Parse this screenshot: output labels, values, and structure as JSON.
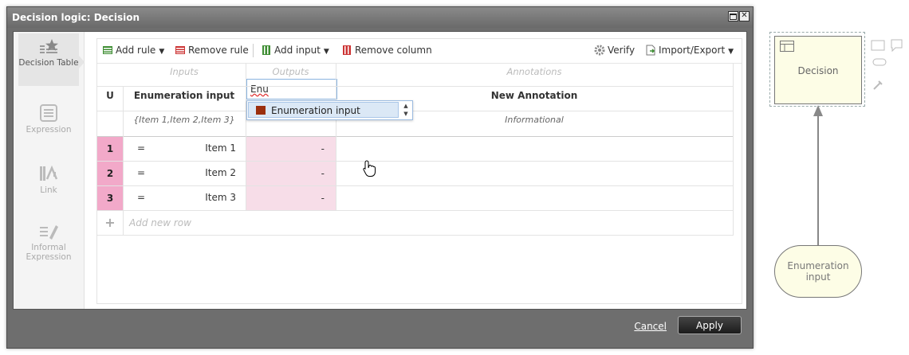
{
  "dialog": {
    "title": "Decision logic: Decision",
    "cancel_label": "Cancel",
    "apply_label": "Apply"
  },
  "nav": {
    "items": [
      {
        "label": "Decision Table",
        "icon": "decision-table-icon",
        "active": true
      },
      {
        "label": "Expression",
        "icon": "expression-icon",
        "active": false
      },
      {
        "label": "Link",
        "icon": "link-icon",
        "active": false
      },
      {
        "label": "Informal Expression",
        "icon": "informal-expression-icon",
        "active": false
      }
    ]
  },
  "toolbar": {
    "add_rule": "Add rule",
    "remove_rule": "Remove rule",
    "add_input": "Add input",
    "remove_column": "Remove column",
    "verify": "Verify",
    "import_export": "Import/Export"
  },
  "table": {
    "section_inputs": "Inputs",
    "section_outputs": "Outputs",
    "section_annotations": "Annotations",
    "hit_policy": "U",
    "input_header": "Enumeration input",
    "output_input_value": "Enu",
    "annotation_header": "New Annotation",
    "input_values_hint": "{Item 1,Item 2,Item 3}",
    "annotation_type": "Informational",
    "rows": [
      {
        "num": "1",
        "op": "=",
        "input": "Item 1",
        "output": "-"
      },
      {
        "num": "2",
        "op": "=",
        "input": "Item 2",
        "output": "-"
      },
      {
        "num": "3",
        "op": "=",
        "input": "Item 3",
        "output": "-"
      }
    ],
    "add_row_placeholder": "Add new row",
    "add_row_symbol": "+"
  },
  "autocomplete": {
    "items": [
      {
        "label": "Enumeration input",
        "swatch_color": "#9b2f0e"
      }
    ]
  },
  "diagram": {
    "decision_label": "Decision",
    "input_label": "Enumeration input"
  },
  "colors": {
    "rule_number_bg": "#f2a9c9",
    "output_cell_bg": "#f7dde8",
    "node_fill": "#fdfde6"
  }
}
